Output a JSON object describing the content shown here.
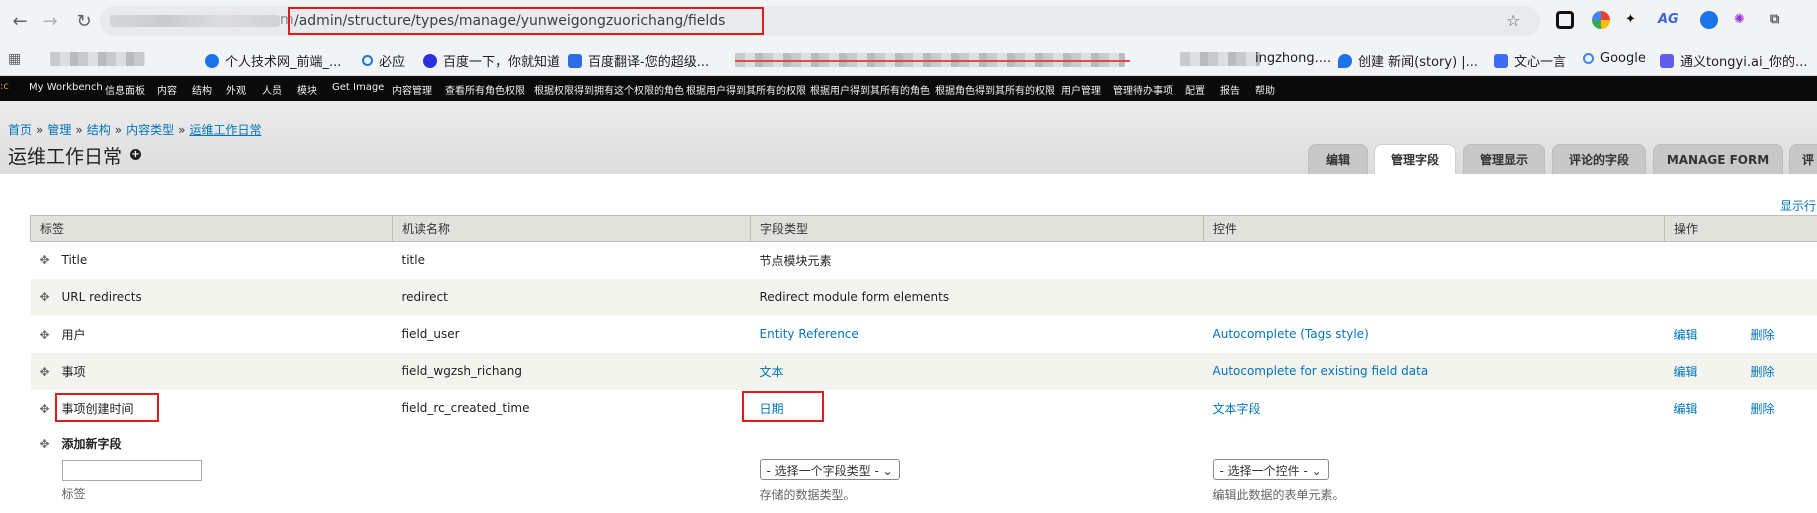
{
  "browser": {
    "url_prefix": "m",
    "url": "/admin/structure/types/manage/yunweigongzuorichang/fields",
    "extensions": [
      "AG"
    ]
  },
  "bookmarks": [
    {
      "label": "个人技术网_前端_...",
      "color": "#1a73e8"
    },
    {
      "label": "必应",
      "color": "#5f6368"
    },
    {
      "label": "百度一下，你就知道",
      "color": "#2932e1"
    },
    {
      "label": "百度翻译-您的超级...",
      "color": "#2b6de8"
    },
    {
      "label": "ingzhong....",
      "color": "#ffffff"
    },
    {
      "label": "创建 新闻(story) |...",
      "color": "#1a73e8"
    },
    {
      "label": "文心一言",
      "color": "#3b6cf6"
    },
    {
      "label": "Google",
      "color": "#4285f4"
    },
    {
      "label": "通义tongyi.ai_你的...",
      "color": "#615ced"
    }
  ],
  "admin_menu": [
    "My Workbench",
    "信息面板",
    "内容",
    "结构",
    "外观",
    "人员",
    "模块",
    "Get Image",
    "内容管理",
    "查看所有角色权限",
    "根据权限得到拥有这个权限的角色",
    "根据用户得到其所有的权限",
    "根据用户得到其所有的角色",
    "根据角色得到其所有的权限",
    "用户管理",
    "管理待办事项",
    "配置",
    "报告",
    "帮助"
  ],
  "breadcrumb": {
    "items": [
      "首页",
      "管理",
      "结构",
      "内容类型"
    ],
    "current": "运维工作日常"
  },
  "page_title": "运维工作日常",
  "tabs": [
    {
      "label": "编辑",
      "active": false
    },
    {
      "label": "管理字段",
      "active": true
    },
    {
      "label": "管理显示",
      "active": false
    },
    {
      "label": "评论的字段",
      "active": false
    },
    {
      "label": "MANAGE FORM",
      "active": false
    },
    {
      "label": "评",
      "active": false
    }
  ],
  "show_row_weights": "显示行",
  "table": {
    "headers": [
      "标签",
      "机读名称",
      "字段类型",
      "控件",
      "操作"
    ],
    "rows": [
      {
        "label": "Title",
        "machine": "title",
        "type": "节点模块元素",
        "type_link": false,
        "widget": "",
        "edit": "",
        "del": ""
      },
      {
        "label": "URL redirects",
        "machine": "redirect",
        "type": "Redirect module form elements",
        "type_link": false,
        "widget": "",
        "edit": "",
        "del": ""
      },
      {
        "label": "用户",
        "machine": "field_user",
        "type": "Entity Reference",
        "type_link": true,
        "widget": "Autocomplete (Tags style)",
        "edit": "编辑",
        "del": "删除"
      },
      {
        "label": "事项",
        "machine": "field_wgzsh_richang",
        "type": "文本",
        "type_link": true,
        "widget": "Autocomplete for existing field data",
        "edit": "编辑",
        "del": "删除"
      },
      {
        "label": "事项创建时间",
        "machine": "field_rc_created_time",
        "type": "日期",
        "type_link": true,
        "widget": "文本字段",
        "edit": "编辑",
        "del": "删除"
      }
    ],
    "add_new": {
      "title": "添加新字段",
      "label_desc": "标签",
      "type_select": "- 选择一个字段类型 -",
      "type_desc": "存储的数据类型。",
      "widget_select": "- 选择一个控件 -",
      "widget_desc": "编辑此数据的表单元素。"
    }
  },
  "colors": {
    "link": "#0074bd",
    "highlight": "#e01b1b",
    "admin_bar": "#0a0a0a"
  }
}
